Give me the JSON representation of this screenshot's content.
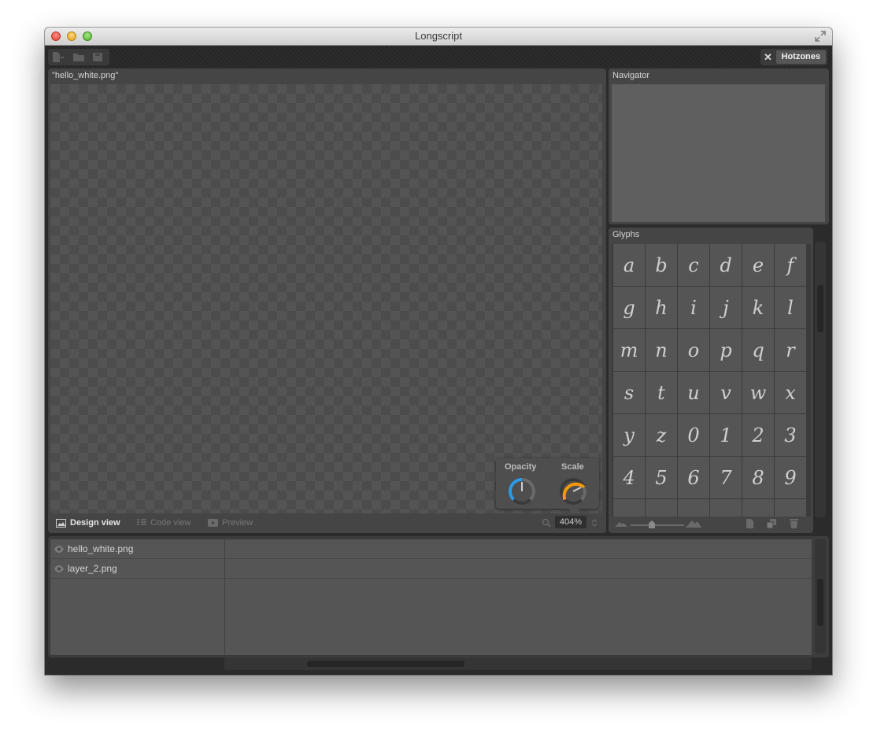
{
  "window": {
    "title": "Longscript"
  },
  "toolbar": {
    "hotzones_label": "Hotzones"
  },
  "document": {
    "filename": "\"hello_white.png\""
  },
  "views": [
    {
      "label": "Design view",
      "active": true
    },
    {
      "label": "Code view",
      "active": false
    },
    {
      "label": "Preview",
      "active": false
    }
  ],
  "zoom": {
    "value": "404",
    "unit": "%"
  },
  "popup": {
    "opacity_label": "Opacity",
    "scale_label": "Scale"
  },
  "navigator": {
    "title": "Navigator"
  },
  "glyphs": {
    "title": "Glyphs",
    "rows": [
      [
        "a",
        "b",
        "c",
        "d",
        "e",
        "f"
      ],
      [
        "g",
        "h",
        "i",
        "j",
        "k",
        "l"
      ],
      [
        "m",
        "n",
        "o",
        "p",
        "q",
        "r"
      ],
      [
        "s",
        "t",
        "u",
        "v",
        "w",
        "x"
      ],
      [
        "y",
        "z",
        "0",
        "1",
        "2",
        "3"
      ],
      [
        "4",
        "5",
        "6",
        "7",
        "8",
        "9"
      ]
    ]
  },
  "layers": [
    {
      "name": "hello_white.png"
    },
    {
      "name": "layer_2.png"
    }
  ],
  "colors": {
    "opacity_dial": "#2b9be6",
    "scale_dial": "#f2980b"
  },
  "icons": {
    "new": "new-document-icon",
    "open": "folder-icon",
    "save": "save-icon",
    "eye": "eye-icon",
    "search": "search-icon",
    "trash": "trash-icon"
  }
}
